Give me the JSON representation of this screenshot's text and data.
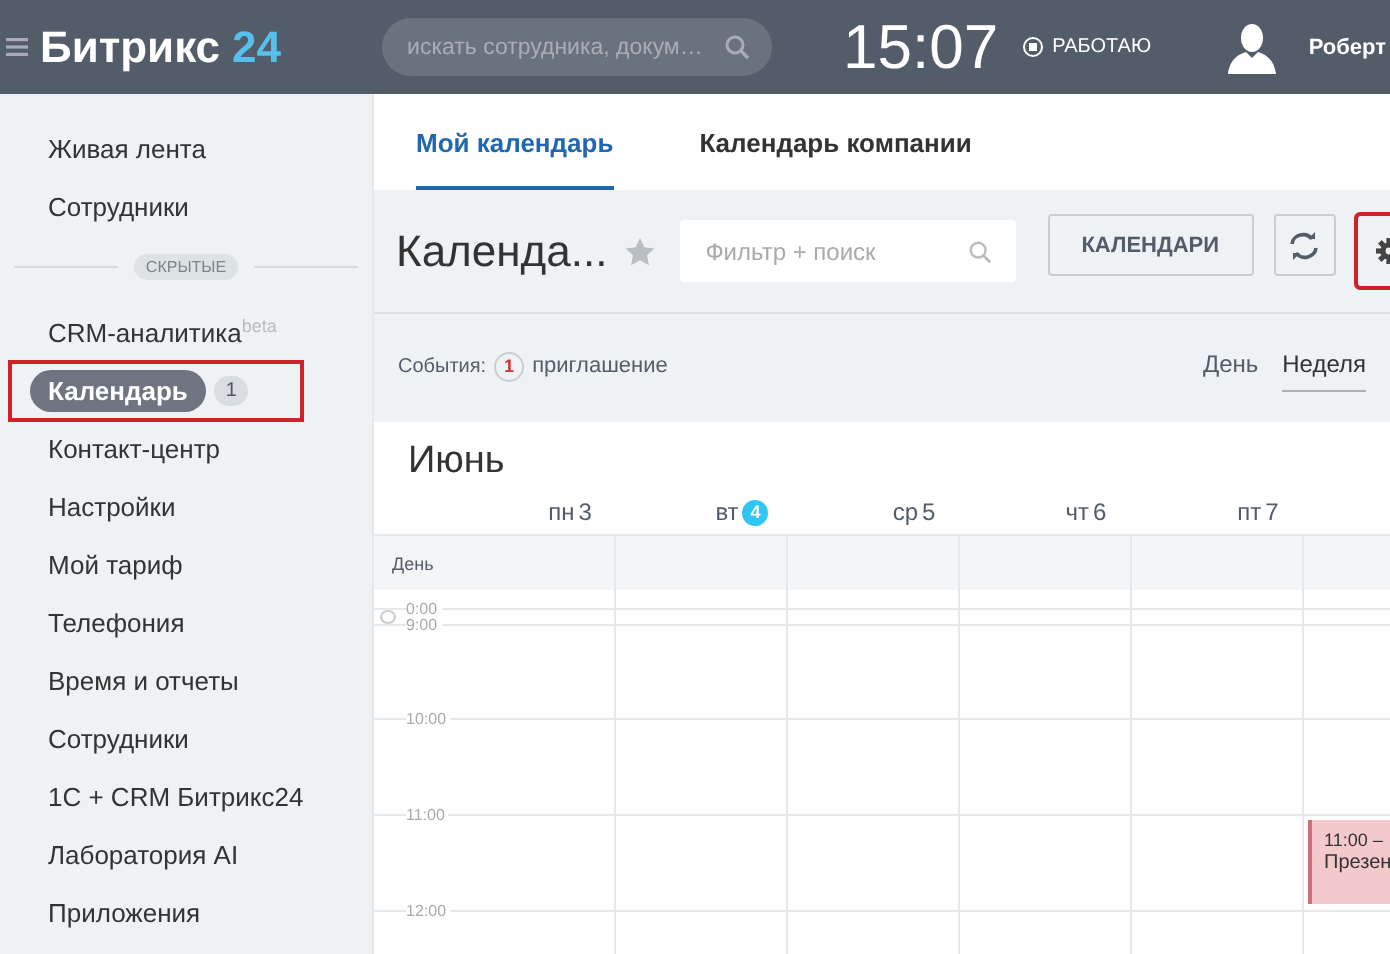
{
  "header": {
    "logo": {
      "name": "Битрикс",
      "number": "24"
    },
    "search": {
      "placeholder": "искать сотрудника, докум…"
    },
    "time": "15:07",
    "status": "РАБОТАЮ",
    "user": "Роберт"
  },
  "sidebar": {
    "items": [
      {
        "label": "Живая лента",
        "selected": false
      },
      {
        "label": "Сотрудники",
        "selected": false
      }
    ],
    "hidden_label": "СКРЫТЫЕ",
    "hidden_items": [
      {
        "label": "CRM-аналитика",
        "tag": "beta",
        "selected": false
      },
      {
        "label": "Календарь",
        "counter": "1",
        "selected": true,
        "highlighted": true
      },
      {
        "label": "Контакт-центр",
        "selected": false
      },
      {
        "label": "Настройки",
        "selected": false
      },
      {
        "label": "Мой тариф",
        "selected": false
      },
      {
        "label": "Телефония",
        "selected": false
      },
      {
        "label": "Время и отчеты",
        "selected": false
      },
      {
        "label": "Сотрудники",
        "selected": false
      },
      {
        "label": "1С + CRM Битрикс24",
        "selected": false
      },
      {
        "label": "Лаборатория AI",
        "selected": false
      },
      {
        "label": "Приложения",
        "selected": false
      }
    ]
  },
  "tabs": [
    {
      "label": "Мой календарь",
      "selected": true
    },
    {
      "label": "Календарь компании",
      "selected": false
    }
  ],
  "toolbar": {
    "title": "Календа...",
    "filter": {
      "placeholder": "Фильтр + поиск"
    },
    "buttons": [
      {
        "kind": "text",
        "label": "КАЛЕНДАРИ",
        "highlighted": false
      },
      {
        "kind": "sync",
        "highlighted": false
      },
      {
        "kind": "settings",
        "highlighted": true
      }
    ]
  },
  "events_bar": {
    "label": "События:",
    "count": "1",
    "text": "приглашение"
  },
  "views": [
    {
      "label": "День",
      "selected": false
    },
    {
      "label": "Неделя",
      "selected": true
    }
  ],
  "calendar": {
    "month": "Июнь",
    "days": [
      {
        "name": "пн",
        "number": "3",
        "today": false
      },
      {
        "name": "вт",
        "number": "4",
        "today": true
      },
      {
        "name": "ср",
        "number": "5",
        "today": false
      },
      {
        "name": "чт",
        "number": "6",
        "today": false
      },
      {
        "name": "пт",
        "number": "7",
        "today": false
      }
    ],
    "all_day_label": "День",
    "rows": [
      {
        "label": "0:00",
        "kind": "collapsed"
      },
      {
        "label": "9:00",
        "kind": "hour"
      },
      {
        "label": "10:00",
        "kind": "hour"
      },
      {
        "label": "11:00",
        "kind": "hour",
        "events": [
          {
            "time": "11:00 –",
            "title": "Презен",
            "color": "#f3c9cc"
          }
        ]
      },
      {
        "label": "12:00",
        "kind": "hour"
      }
    ]
  }
}
